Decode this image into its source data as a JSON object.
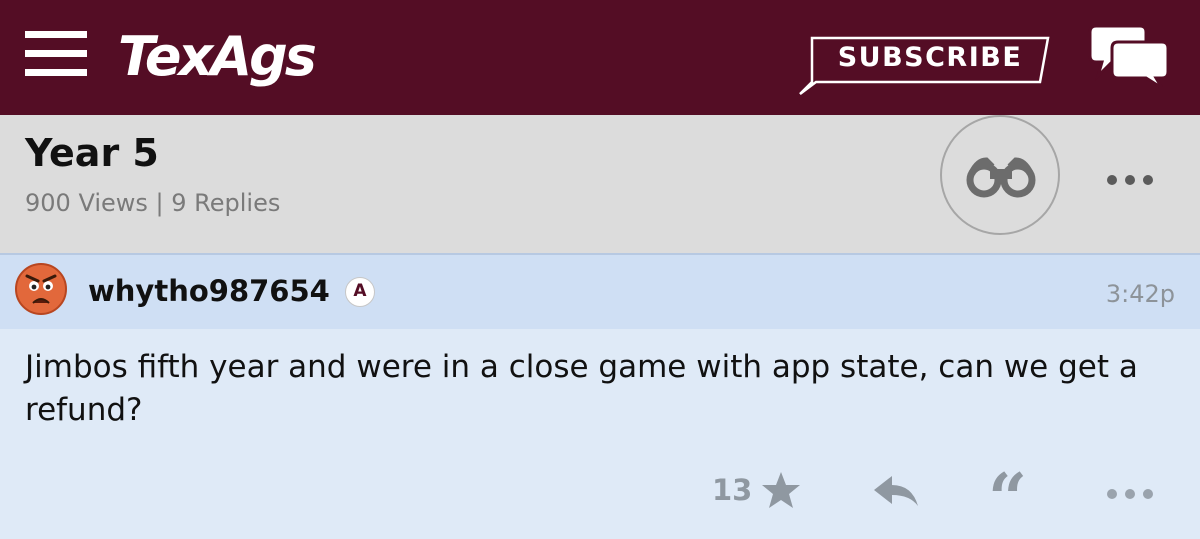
{
  "header": {
    "logo_text": "TexAgs",
    "subscribe_label": "SUBSCRIBE",
    "brand_color": "#540d25",
    "icons": [
      "menu-icon",
      "chat-bubbles-icon"
    ]
  },
  "thread": {
    "title": "Year 5",
    "stats": "900 Views | 9 Replies",
    "icons": [
      "binoculars-icon",
      "more-icon"
    ]
  },
  "post": {
    "username": "whytho987654",
    "badge": "A",
    "time": "3:42p",
    "body": "Jimbos fifth year and were in a close game with app state, can we get a refund?",
    "rating_count": "13",
    "icons": [
      "angry-face-avatar",
      "star-icon",
      "reply-icon",
      "quote-icon",
      "more-icon"
    ]
  }
}
